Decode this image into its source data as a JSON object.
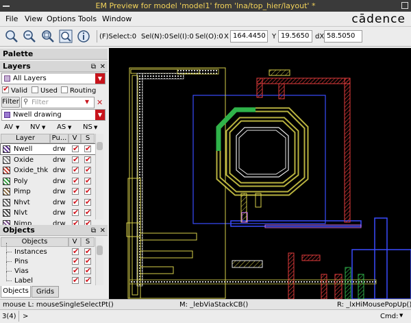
{
  "window": {
    "title": "EM Preview for model 'model1' from 'lna/top_hier/layout' *"
  },
  "menu": {
    "items": [
      "File",
      "View",
      "Options",
      "Tools",
      "Window"
    ]
  },
  "brand": "cādence",
  "toolbar": {
    "fselect": "(F)Select:0",
    "seln": "Sel(N):0",
    "seli": "Sel(I):0",
    "selo": "Sel(O):0",
    "x_label": "X",
    "x_value": "164.4450",
    "y_label": "Y",
    "y_value": "19.5650",
    "dx_label": "dX",
    "dx_value": "58.5050"
  },
  "palette": {
    "title": "Palette"
  },
  "layers": {
    "title": "Layers",
    "filter_combo": "All Layers",
    "valid": "Valid",
    "used": "Used",
    "routing": "Routing",
    "filter_btn": "Filter",
    "filter_placeholder": "Filter",
    "current_layer": "Nwell drawing",
    "tabs": [
      "AV",
      "NV",
      "AS",
      "NS"
    ],
    "columns": [
      "Layer",
      "Pu...",
      "V",
      "S"
    ],
    "rows": [
      {
        "name": "Nwell",
        "purpose": "drw",
        "color": "#5a2d91"
      },
      {
        "name": "Oxide",
        "purpose": "drw",
        "color": "#8d8d8d"
      },
      {
        "name": "Oxide_thk",
        "purpose": "drw",
        "color": "#c43a2a"
      },
      {
        "name": "Poly",
        "purpose": "drw",
        "color": "#2f9a3a"
      },
      {
        "name": "Pimp",
        "purpose": "drw",
        "color": "#8a6a40"
      },
      {
        "name": "Nhvt",
        "purpose": "drw",
        "color": "#6a6a6a"
      },
      {
        "name": "Nlvt",
        "purpose": "drw",
        "color": "#4a4a4a"
      },
      {
        "name": "Nimp",
        "purpose": "drw",
        "color": "#7a4c8c"
      }
    ]
  },
  "objects": {
    "title": "Objects",
    "columns": [
      "Objects",
      "V",
      "S"
    ],
    "rows": [
      "Instances",
      "Pins",
      "Vias",
      "Label"
    ],
    "tabs": [
      "Objects",
      "Grids"
    ]
  },
  "status": {
    "left": "mouse L: mouseSingleSelectPt()",
    "mid": "M: _lebViaStackCB()",
    "right": "R: _lxHiMousePopUp()"
  },
  "bottom": {
    "left": "3(4)",
    "prompt": ">",
    "cmd_label": "Cmd:"
  },
  "colors": {
    "title_text": "#f3d35a",
    "accent": "#c8141c",
    "canvas": "#000000"
  }
}
